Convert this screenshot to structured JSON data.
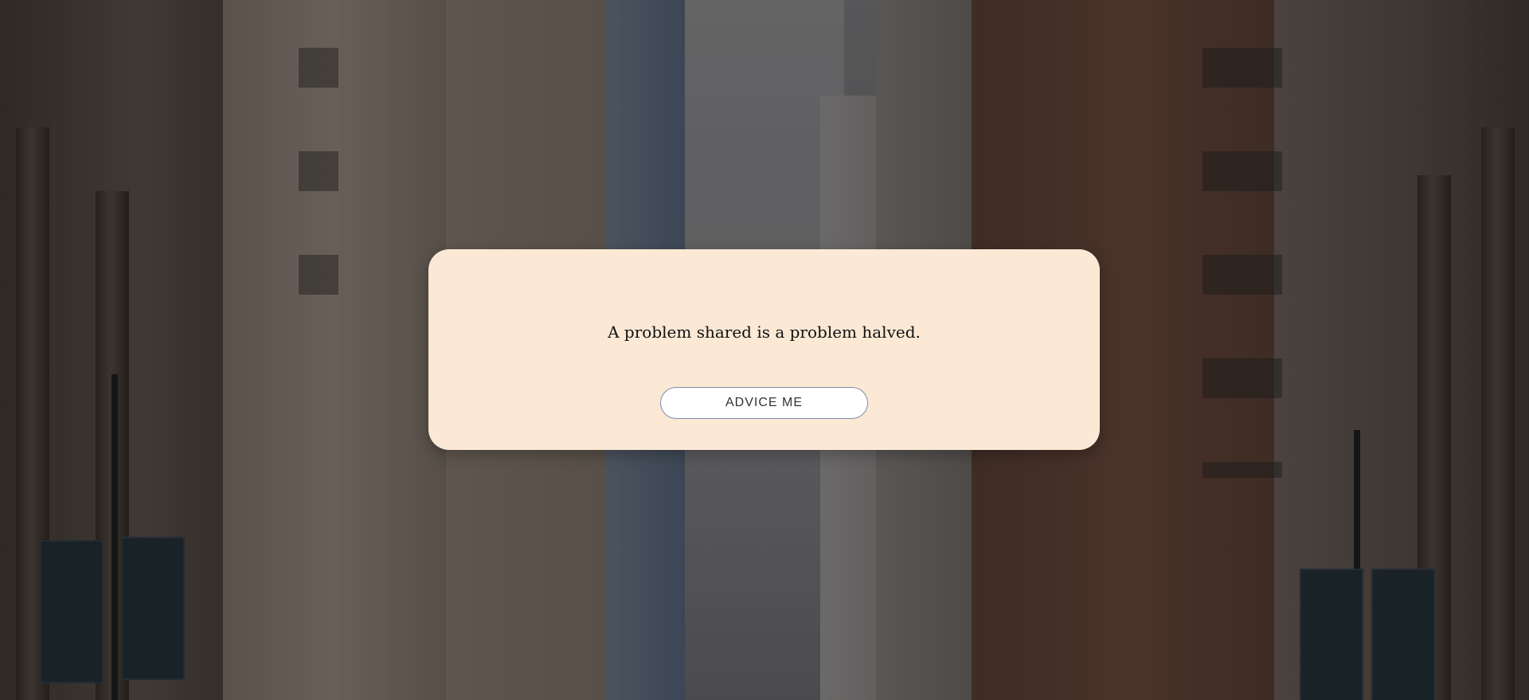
{
  "background": {
    "description_icon": "city-street-photo"
  },
  "card": {
    "quote": "A problem shared is a problem halved.",
    "button_label": "ADVICE ME"
  },
  "colors": {
    "card_background": "#fbe9d5",
    "button_border": "#7d8cad",
    "text": "#111111"
  }
}
